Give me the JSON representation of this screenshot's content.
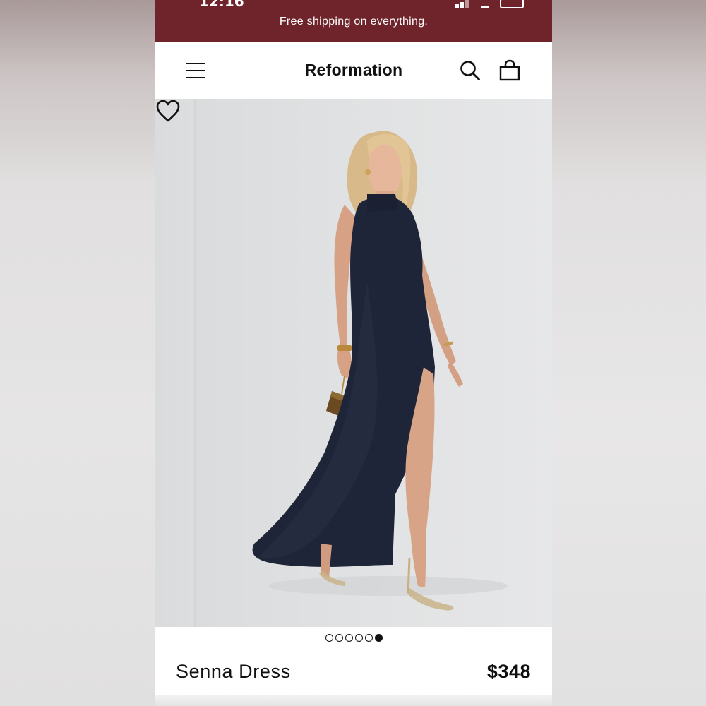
{
  "status_bar": {
    "time": "12:16"
  },
  "banner": {
    "text": "Free shipping on everything."
  },
  "header": {
    "brand": "Reformation",
    "menu_icon": "hamburger-menu-icon",
    "search_icon": "search-icon",
    "bag_icon": "shopping-bag-icon"
  },
  "gallery": {
    "favorite_icon": "heart-icon",
    "image_subject": "model wearing navy high-neck maxi dress with side slit",
    "total_images": 6,
    "active_index": 6
  },
  "product": {
    "name": "Senna Dress",
    "price": "$348"
  },
  "colors": {
    "banner": "#6e242a",
    "dress": "#1f2538"
  }
}
